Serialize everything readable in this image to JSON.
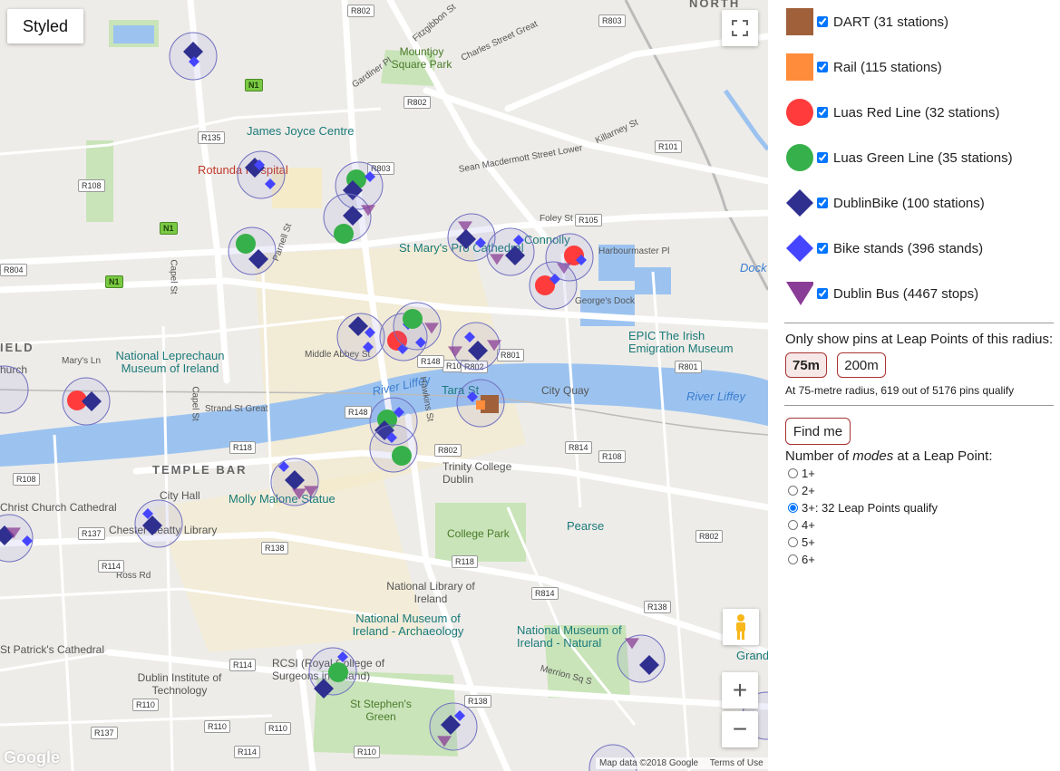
{
  "map": {
    "styled_button": "Styled",
    "google_logo": "Google",
    "attribution": {
      "map_data": "Map data ©2018 Google",
      "terms": "Terms of Use"
    },
    "zoom_in": "+",
    "zoom_out": "−",
    "fullscreen_icon": "fullscreen-icon",
    "pegman_icon": "pegman-icon",
    "labels": {
      "north": "NORTH",
      "mountjoy_square": "Mountjoy Square Park",
      "james_joyce": "James Joyce Centre",
      "rotunda": "Rotunda Hospital",
      "st_marys": "St Mary's Pro Cathedral",
      "connolly": "Connolly",
      "dock": "Dock",
      "epic": "EPIC The Irish Emigration Museum",
      "leprechaun": "National Leprechaun Museum of Ireland",
      "river_liffey_1": "River Liffey",
      "river_liffey_2": "River Liffey",
      "tara_st": "Tara St",
      "city_quay": "City Quay",
      "temple_bar": "TEMPLE BAR",
      "trinity": "Trinity College Dublin",
      "city_hall": "City Hall",
      "molly_malone": "Molly Malone Statue",
      "christ_church": "Christ Church Cathedral",
      "chester_beatty": "Chester Beatty Library",
      "college_park": "College Park",
      "pearse": "Pearse",
      "national_library": "National Library of Ireland",
      "national_museum_arch": "National Museum of Ireland - Archaeology",
      "national_museum_nat": "National Museum of Ireland - Natural",
      "st_patricks": "St Patrick's Cathedral",
      "dublin_inst": "Dublin Institute of Technology",
      "rcsi": "RCSI (Royal College of Surgeons in Ireland)",
      "st_stephens": "St Stephen's Green",
      "church": "hurch",
      "field": "IELD",
      "grand": "Grand",
      "capel_st_1": "Capel St",
      "capel_st_2": "Capel St",
      "parnell_st": "Parnell St",
      "middle_abbey": "Middle Abbey St",
      "strand_st": "Strand St Great",
      "marys_ln": "Mary's Ln",
      "foley_st": "Foley St",
      "harbourmaster": "Harbourmaster Pl",
      "georges_dock": "George's Dock",
      "sean_mac": "Sean Macdermott Street Lower",
      "gardiner": "Gardiner Pl",
      "fitzgibbon": "Fitzgibbon St",
      "charles_st": "Charles Street Great",
      "killarney": "Killarney St",
      "hawkins": "Hawkins St",
      "ross_rd": "Ross Rd",
      "merrion_sq": "Merrion Sq S"
    },
    "roads": [
      "R802",
      "R803",
      "R135",
      "R108",
      "R804",
      "R803",
      "R802",
      "R101",
      "R105",
      "R105",
      "R801",
      "R801",
      "R802",
      "R148",
      "R148",
      "R118",
      "R802",
      "R814",
      "R108",
      "R108",
      "R137",
      "R114",
      "R138",
      "R118",
      "R814",
      "R802",
      "R114",
      "R110",
      "R137",
      "R110",
      "R138",
      "R110",
      "R110",
      "R114",
      "R138"
    ],
    "national_roads": [
      "N1",
      "N1",
      "N1"
    ]
  },
  "legend": [
    {
      "label": "DART (31 stations)",
      "color": "#a0603a",
      "shape": "square",
      "checked": true
    },
    {
      "label": "Rail (115 stations)",
      "color": "#ff8c3a",
      "shape": "square",
      "checked": true
    },
    {
      "label": "Luas Red Line (32 stations)",
      "color": "#ff3b3b",
      "shape": "circle",
      "checked": true
    },
    {
      "label": "Luas Green Line (35 stations)",
      "color": "#36b04a",
      "shape": "circle",
      "checked": true
    },
    {
      "label": "DublinBike (100 stations)",
      "color": "#2f2f8f",
      "shape": "diamond",
      "checked": true
    },
    {
      "label": "Bike stands (396 stands)",
      "color": "#4545ff",
      "shape": "diamond",
      "checked": true
    },
    {
      "label": "Dublin Bus (4467 stops)",
      "color": "#8a3d96",
      "shape": "triangle",
      "checked": true
    }
  ],
  "radius": {
    "label": "Only show pins at Leap Points of this radius:",
    "options": [
      "75m",
      "200m"
    ],
    "selected": "75m",
    "summary": "At 75-metre radius, 619 out of 5176 pins qualify"
  },
  "find_me_label": "Find me",
  "modes": {
    "label_prefix": "Number of ",
    "label_em": "modes",
    "label_suffix": " at a Leap Point:",
    "options": [
      "1+",
      "2+",
      "3+: 32 Leap Points qualify",
      "4+",
      "5+",
      "6+"
    ],
    "selected_index": 2
  }
}
